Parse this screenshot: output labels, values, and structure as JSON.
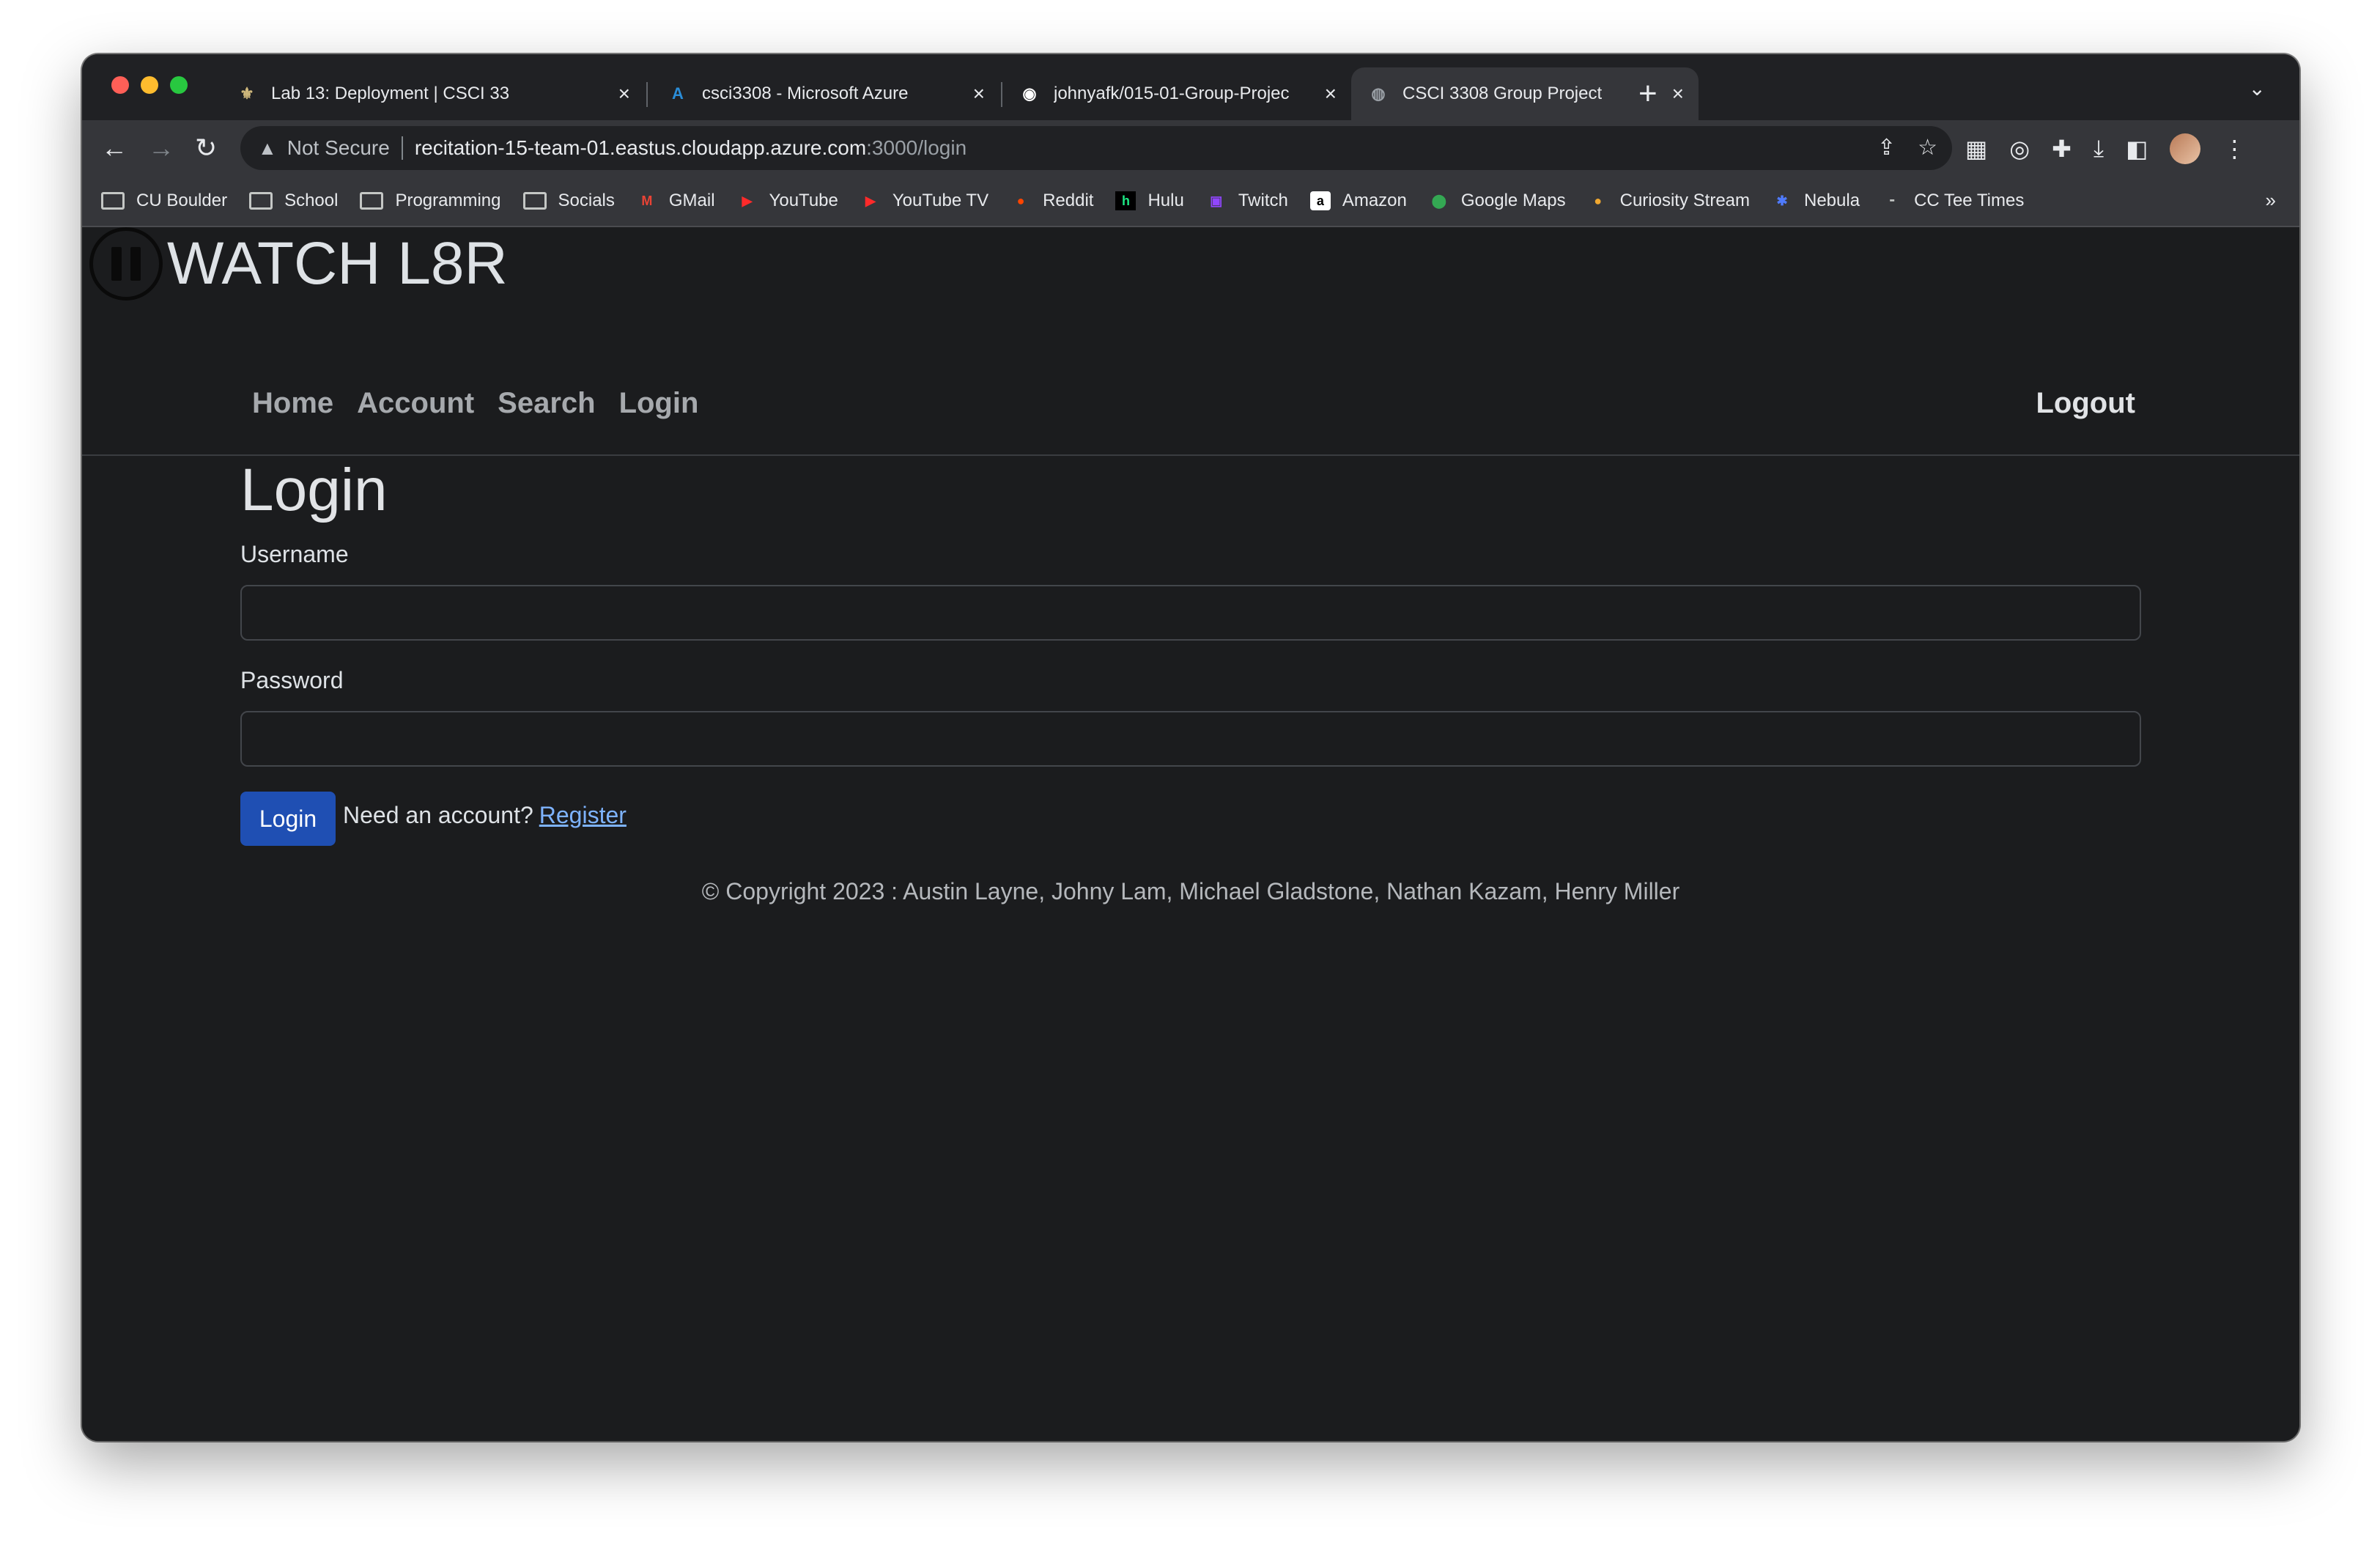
{
  "browser": {
    "tabs": [
      {
        "title": "Lab 13: Deployment | CSCI 33",
        "favicon": "cu-icon",
        "active": false
      },
      {
        "title": "csci3308 - Microsoft Azure",
        "favicon": "azure-icon",
        "active": false
      },
      {
        "title": "johnyafk/015-01-Group-Projec",
        "favicon": "github-icon",
        "active": false
      },
      {
        "title": "CSCI 3308 Group Project",
        "favicon": "globe-icon",
        "active": true
      }
    ],
    "address": {
      "security": "Not Secure",
      "host": "recitation-15-team-01.eastus.cloudapp.azure.com",
      "path": ":3000/login"
    },
    "bookmarks": [
      {
        "label": "CU Boulder",
        "icon": "folder-icon"
      },
      {
        "label": "School",
        "icon": "folder-icon"
      },
      {
        "label": "Programming",
        "icon": "folder-icon"
      },
      {
        "label": "Socials",
        "icon": "folder-icon"
      },
      {
        "label": "GMail",
        "icon": "gmail-icon",
        "glyph": "M",
        "color": "#ea4335"
      },
      {
        "label": "YouTube",
        "icon": "youtube-icon",
        "glyph": "▶",
        "color": "#ff0000"
      },
      {
        "label": "YouTube TV",
        "icon": "youtube-tv-icon",
        "glyph": "▶",
        "color": "#ff0000"
      },
      {
        "label": "Reddit",
        "icon": "reddit-icon",
        "glyph": "●",
        "color": "#ff4500"
      },
      {
        "label": "Hulu",
        "icon": "hulu-icon",
        "glyph": "h",
        "color": "#1ce783"
      },
      {
        "label": "Twitch",
        "icon": "twitch-icon",
        "glyph": "▣",
        "color": "#9146ff"
      },
      {
        "label": "Amazon",
        "icon": "amazon-icon",
        "glyph": "a",
        "color": "#ffffff"
      },
      {
        "label": "Google Maps",
        "icon": "google-maps-icon",
        "glyph": "⬤",
        "color": "#34a853"
      },
      {
        "label": "Curiosity Stream",
        "icon": "curiosity-stream-icon",
        "glyph": "●",
        "color": "#f0a830"
      },
      {
        "label": "Nebula",
        "icon": "nebula-icon",
        "glyph": "✱",
        "color": "#4f7bff"
      },
      {
        "label": "CC Tee Times",
        "icon": "cc-tee-times-icon",
        "glyph": "⁃",
        "color": "#c4c7c5"
      }
    ]
  },
  "site": {
    "brand": "WATCH L8R",
    "nav": [
      "Home",
      "Account",
      "Search",
      "Login"
    ],
    "logout": "Logout"
  },
  "login": {
    "title": "Login",
    "username_label": "Username",
    "username_value": "",
    "password_label": "Password",
    "password_value": "",
    "button": "Login",
    "need_account": "Need an account?",
    "register": "Register"
  },
  "footer": {
    "copyright": "© Copyright 2023 : Austin Layne, Johny Lam, Michael Gladstone, Nathan Kazam, Henry Miller"
  }
}
